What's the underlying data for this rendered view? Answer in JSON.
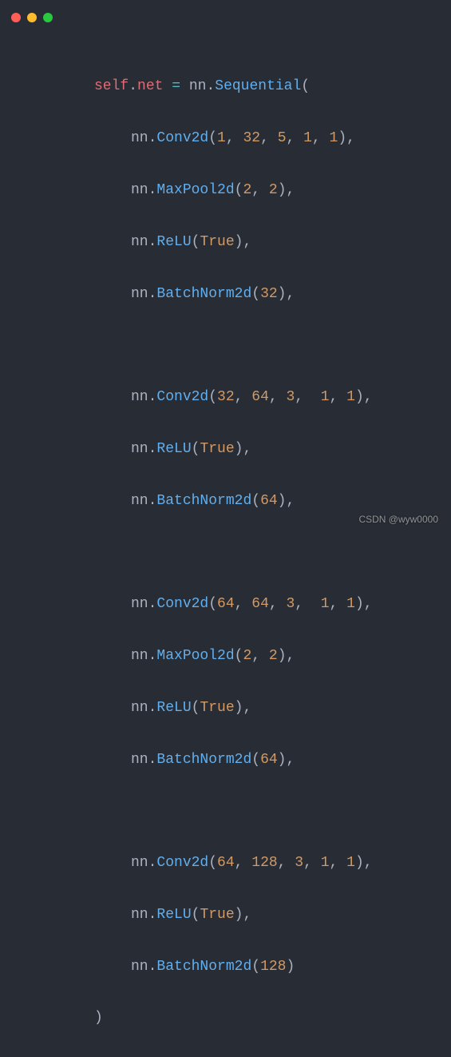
{
  "window": {
    "controls": [
      "close",
      "minimize",
      "maximize"
    ]
  },
  "code": {
    "line1": {
      "self": "self",
      "dot1": ".",
      "net": "net",
      "eq": " = ",
      "nn": "nn",
      "dot2": ".",
      "seq": "Sequential",
      "open": "("
    },
    "block1": {
      "conv": {
        "nn": "nn",
        "dot": ".",
        "fn": "Conv2d",
        "open": "(",
        "a": "1",
        "c1": ", ",
        "b": "32",
        "c2": ", ",
        "c": "5",
        "c3": ", ",
        "d": "1",
        "c4": ", ",
        "e": "1",
        "close": "),"
      },
      "pool": {
        "nn": "nn",
        "dot": ".",
        "fn": "MaxPool2d",
        "open": "(",
        "a": "2",
        "c1": ", ",
        "b": "2",
        "close": "),"
      },
      "relu": {
        "nn": "nn",
        "dot": ".",
        "fn": "ReLU",
        "open": "(",
        "a": "True",
        "close": "),"
      },
      "bn": {
        "nn": "nn",
        "dot": ".",
        "fn": "BatchNorm2d",
        "open": "(",
        "a": "32",
        "close": "),"
      }
    },
    "block2": {
      "conv": {
        "nn": "nn",
        "dot": ".",
        "fn": "Conv2d",
        "open": "(",
        "a": "32",
        "c1": ", ",
        "b": "64",
        "c2": ", ",
        "c": "3",
        "c3": ",  ",
        "d": "1",
        "c4": ", ",
        "e": "1",
        "close": "),"
      },
      "relu": {
        "nn": "nn",
        "dot": ".",
        "fn": "ReLU",
        "open": "(",
        "a": "True",
        "close": "),"
      },
      "bn": {
        "nn": "nn",
        "dot": ".",
        "fn": "BatchNorm2d",
        "open": "(",
        "a": "64",
        "close": "),"
      }
    },
    "block3": {
      "conv": {
        "nn": "nn",
        "dot": ".",
        "fn": "Conv2d",
        "open": "(",
        "a": "64",
        "c1": ", ",
        "b": "64",
        "c2": ", ",
        "c": "3",
        "c3": ",  ",
        "d": "1",
        "c4": ", ",
        "e": "1",
        "close": "),"
      },
      "pool": {
        "nn": "nn",
        "dot": ".",
        "fn": "MaxPool2d",
        "open": "(",
        "a": "2",
        "c1": ", ",
        "b": "2",
        "close": "),"
      },
      "relu": {
        "nn": "nn",
        "dot": ".",
        "fn": "ReLU",
        "open": "(",
        "a": "True",
        "close": "),"
      },
      "bn": {
        "nn": "nn",
        "dot": ".",
        "fn": "BatchNorm2d",
        "open": "(",
        "a": "64",
        "close": "),"
      }
    },
    "block4": {
      "conv": {
        "nn": "nn",
        "dot": ".",
        "fn": "Conv2d",
        "open": "(",
        "a": "64",
        "c1": ", ",
        "b": "128",
        "c2": ", ",
        "c": "3",
        "c3": ", ",
        "d": "1",
        "c4": ", ",
        "e": "1",
        "close": "),"
      },
      "relu": {
        "nn": "nn",
        "dot": ".",
        "fn": "ReLU",
        "open": "(",
        "a": "True",
        "close": "),"
      },
      "bn": {
        "nn": "nn",
        "dot": ".",
        "fn": "BatchNorm2d",
        "open": "(",
        "a": "128",
        "close": ")"
      }
    },
    "closeParen": ")"
  },
  "watermark": "CSDN @wyw0000"
}
